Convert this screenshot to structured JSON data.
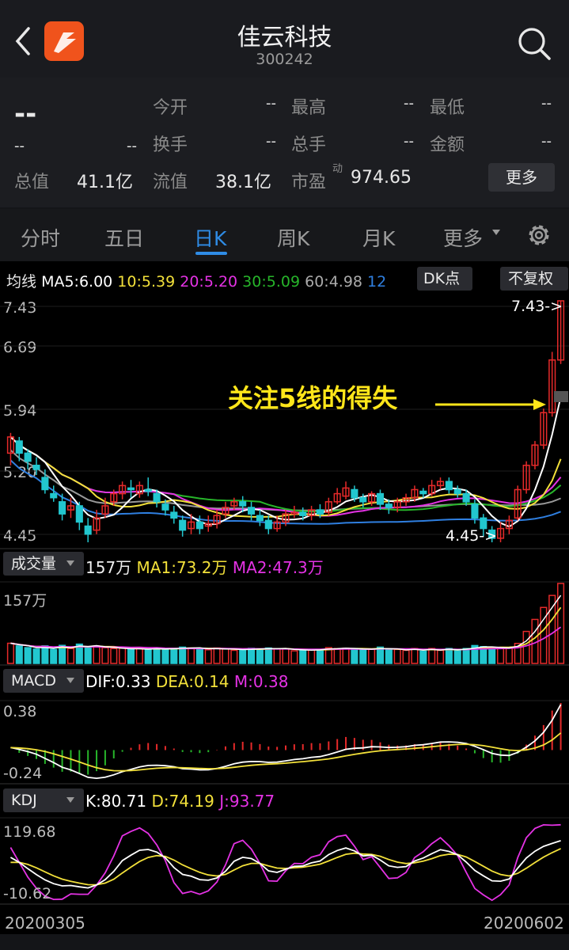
{
  "header": {
    "title": "佳云科技",
    "code": "300242",
    "back_icon": "chevron-left-icon",
    "search_icon": "search-icon",
    "logo_icon": "app-logo-icon"
  },
  "quote": {
    "price": "--",
    "change": "--",
    "change_pct": "--",
    "open_label": "今开",
    "open_value": "--",
    "high_label": "最高",
    "high_value": "--",
    "low_label": "最低",
    "low_value": "--",
    "turnover_label": "换手",
    "turnover_value": "--",
    "volume_label": "总手",
    "volume_value": "--",
    "amount_label": "金额",
    "amount_value": "--",
    "mktcap_label": "总值",
    "mktcap_value": "41.1亿",
    "float_label": "流值",
    "float_value": "38.1亿",
    "pe_label": "市盈",
    "pe_sup": "动",
    "pe_value": "974.65",
    "more_button": "更多"
  },
  "tabs": [
    "分时",
    "五日",
    "日K",
    "周K",
    "月K",
    "更多"
  ],
  "active_tab": 2,
  "ma_legend": {
    "label": "均线",
    "ma5": "MA5:6.00",
    "ma10": "10:5.39",
    "ma20": "20:5.20",
    "ma30": "30:5.09",
    "ma60": "60:4.98",
    "ma120": "12",
    "dk_button": "DK点",
    "adjust_button": "不复权"
  },
  "price_axis": [
    "7.43",
    "6.69",
    "5.94",
    "5.20",
    "4.45"
  ],
  "annotations": {
    "high_marker": "7.43->",
    "low_marker": "4.45->",
    "callout": "关注5线的得失"
  },
  "volume_panel": {
    "selector": "成交量",
    "value": "157万",
    "ma1": "MA1:73.2万",
    "ma2": "MA2:47.3万",
    "axis_top": "157万"
  },
  "macd_panel": {
    "selector": "MACD",
    "dif": "DIF:0.33",
    "dea": "DEA:0.14",
    "m": "M:0.38",
    "axis_top": "0.38",
    "axis_bottom": "-0.24"
  },
  "kdj_panel": {
    "selector": "KDJ",
    "k": "K:80.71",
    "d": "D:74.19",
    "j": "J:93.77",
    "axis_top": "119.68",
    "axis_bottom": "-10.62"
  },
  "dates": {
    "start": "20200305",
    "end": "20200602"
  },
  "colors": {
    "up": "#e62a2a",
    "down": "#22c7cf",
    "ma5": "#ffffff",
    "ma10": "#f2e03a",
    "ma20": "#e432e4",
    "ma30": "#27b52a",
    "ma60": "#999999",
    "ma120": "#2f7fe0",
    "accent": "#2f8ce6",
    "callout": "#ffe61a"
  },
  "chart_data": {
    "type": "candlestick",
    "y_range": [
      4.45,
      7.43
    ],
    "candles": [
      [
        5.55,
        5.75,
        5.8,
        5.4
      ],
      [
        5.7,
        5.55,
        5.75,
        5.45
      ],
      [
        5.55,
        5.45,
        5.6,
        5.35
      ],
      [
        5.4,
        5.35,
        5.5,
        5.28
      ],
      [
        5.25,
        5.1,
        5.35,
        5.05
      ],
      [
        5.05,
        5.0,
        5.15,
        4.95
      ],
      [
        4.95,
        4.8,
        5.05,
        4.72
      ],
      [
        4.85,
        4.9,
        5.0,
        4.75
      ],
      [
        4.9,
        4.7,
        4.95,
        4.6
      ],
      [
        4.65,
        4.55,
        4.75,
        4.45
      ],
      [
        4.6,
        4.75,
        4.85,
        4.55
      ],
      [
        4.8,
        4.9,
        5.0,
        4.75
      ],
      [
        4.95,
        5.05,
        5.1,
        4.9
      ],
      [
        5.05,
        5.15,
        5.2,
        4.98
      ],
      [
        5.12,
        5.1,
        5.22,
        5.0
      ],
      [
        5.05,
        5.15,
        5.2,
        5.0
      ],
      [
        5.1,
        5.08,
        5.25,
        5.02
      ],
      [
        5.05,
        4.95,
        5.1,
        4.88
      ],
      [
        4.92,
        4.85,
        4.98,
        4.78
      ],
      [
        4.82,
        4.75,
        4.9,
        4.68
      ],
      [
        4.72,
        4.6,
        4.78,
        4.52
      ],
      [
        4.62,
        4.7,
        4.8,
        4.55
      ],
      [
        4.7,
        4.62,
        4.78,
        4.55
      ],
      [
        4.65,
        4.68,
        4.78,
        4.58
      ],
      [
        4.68,
        4.78,
        4.85,
        4.62
      ],
      [
        4.8,
        4.88,
        4.95,
        4.75
      ],
      [
        4.9,
        4.95,
        5.0,
        4.85
      ],
      [
        4.95,
        4.9,
        5.02,
        4.82
      ],
      [
        4.88,
        4.8,
        4.95,
        4.72
      ],
      [
        4.78,
        4.72,
        4.85,
        4.65
      ],
      [
        4.72,
        4.62,
        4.78,
        4.55
      ],
      [
        4.62,
        4.7,
        4.78,
        4.58
      ],
      [
        4.7,
        4.8,
        4.85,
        4.65
      ],
      [
        4.8,
        4.82,
        4.9,
        4.75
      ],
      [
        4.82,
        4.78,
        4.88,
        4.72
      ],
      [
        4.78,
        4.85,
        4.9,
        4.72
      ],
      [
        4.85,
        4.8,
        4.92,
        4.75
      ],
      [
        4.82,
        4.95,
        5.0,
        4.78
      ],
      [
        4.95,
        5.05,
        5.12,
        4.92
      ],
      [
        5.02,
        5.12,
        5.2,
        4.98
      ],
      [
        5.1,
        5.0,
        5.15,
        4.95
      ],
      [
        5.0,
        4.95,
        5.05,
        4.88
      ],
      [
        4.95,
        5.05,
        5.08,
        4.9
      ],
      [
        5.05,
        4.92,
        5.1,
        4.85
      ],
      [
        4.92,
        4.88,
        4.98,
        4.8
      ],
      [
        4.88,
        4.95,
        5.0,
        4.82
      ],
      [
        4.95,
        5.0,
        5.05,
        4.9
      ],
      [
        5.0,
        5.1,
        5.15,
        4.95
      ],
      [
        5.08,
        5.05,
        5.12,
        5.0
      ],
      [
        5.05,
        5.15,
        5.22,
        5.02
      ],
      [
        5.15,
        5.2,
        5.25,
        5.1
      ],
      [
        5.2,
        5.1,
        5.25,
        5.05
      ],
      [
        5.1,
        5.05,
        5.15,
        5.0
      ],
      [
        5.05,
        4.95,
        5.1,
        4.9
      ],
      [
        4.92,
        4.75,
        4.98,
        4.68
      ],
      [
        4.75,
        4.62,
        4.8,
        4.52
      ],
      [
        4.6,
        4.5,
        4.65,
        4.45
      ],
      [
        4.5,
        4.62,
        4.7,
        4.45
      ],
      [
        4.62,
        4.72,
        4.78,
        4.55
      ],
      [
        4.75,
        5.1,
        5.15,
        4.72
      ],
      [
        5.1,
        5.4,
        5.45,
        5.05
      ],
      [
        5.4,
        5.65,
        5.7,
        5.35
      ],
      [
        5.65,
        6.05,
        6.1,
        5.6
      ],
      [
        6.05,
        6.7,
        6.8,
        6.0
      ],
      [
        6.7,
        7.43,
        7.43,
        6.65
      ]
    ],
    "volume_max": 157,
    "macd_range": [
      -0.24,
      0.38
    ],
    "kdj_range": [
      -10.62,
      119.68
    ]
  }
}
